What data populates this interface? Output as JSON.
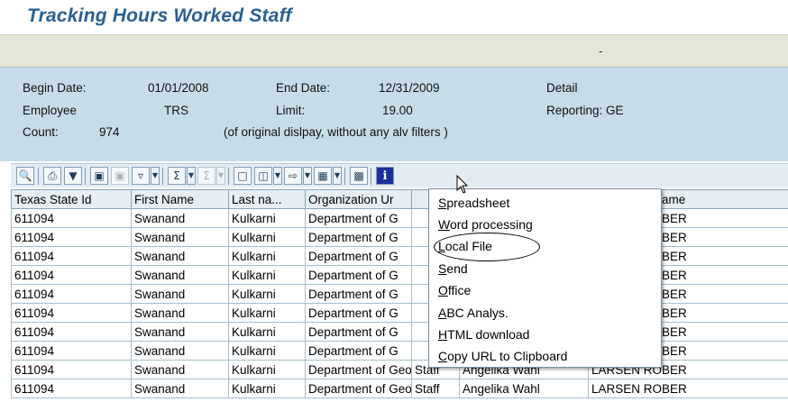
{
  "title": "Tracking Hours Worked Staff",
  "app_toolbar": {
    "indicator": "-"
  },
  "header": {
    "begin_date_label": "Begin Date:",
    "begin_date": "01/01/2008",
    "end_date_label": "End Date:",
    "end_date": "12/31/2009",
    "detail": "Detail",
    "employee_label": "Employee",
    "employee": "TRS",
    "limit_label": "Limit:",
    "limit": "19.00",
    "reporting": "Reporting: GE",
    "count_label": "Count:",
    "count": "974",
    "note": "(of original dislpay, without any alv filters )"
  },
  "toolbar": {
    "icons": [
      "details-icon",
      "print-icon",
      "filter-icon",
      "find-icon",
      "find-next-icon",
      "set-filter-icon",
      "total-icon",
      "subtotal-icon",
      "print-preview-icon",
      "views-icon",
      "export-icon",
      "change-layout-icon",
      "abc-analysis-icon",
      "information-icon"
    ]
  },
  "table": {
    "columns": [
      "Texas State Id",
      "First Name",
      "Last na...",
      "Organization Ur",
      "",
      "",
      "Supervisor Name"
    ],
    "rows": [
      [
        "611094",
        "Swanand",
        "Kulkarni",
        "Department of G",
        "",
        "",
        "LARSEN ROBER"
      ],
      [
        "611094",
        "Swanand",
        "Kulkarni",
        "Department of G",
        "",
        "",
        "LARSEN ROBER"
      ],
      [
        "611094",
        "Swanand",
        "Kulkarni",
        "Department of G",
        "",
        "",
        "LARSEN ROBER"
      ],
      [
        "611094",
        "Swanand",
        "Kulkarni",
        "Department of G",
        "",
        "",
        "LARSEN ROBER"
      ],
      [
        "611094",
        "Swanand",
        "Kulkarni",
        "Department of G",
        "",
        "",
        "LARSEN ROBER"
      ],
      [
        "611094",
        "Swanand",
        "Kulkarni",
        "Department of G",
        "",
        "",
        "LARSEN ROBER"
      ],
      [
        "611094",
        "Swanand",
        "Kulkarni",
        "Department of G",
        "",
        "",
        "LARSEN ROBER"
      ],
      [
        "611094",
        "Swanand",
        "Kulkarni",
        "Department of G",
        "",
        "",
        "LARSEN ROBER"
      ],
      [
        "611094",
        "Swanand",
        "Kulkarni",
        "Department of Geograph",
        "Staff",
        "Angelika Wahl",
        "LARSEN ROBER"
      ],
      [
        "611094",
        "Swanand",
        "Kulkarni",
        "Department of Geograph",
        "Staff",
        "Angelika Wahl",
        "LARSEN ROBER"
      ]
    ]
  },
  "export_menu": {
    "items": [
      "Spreadsheet",
      "Word processing",
      "Local File",
      "Send",
      "Office",
      "ABC Analys.",
      "HTML download",
      "Copy URL to Clipboard"
    ],
    "highlighted": "Local File"
  }
}
